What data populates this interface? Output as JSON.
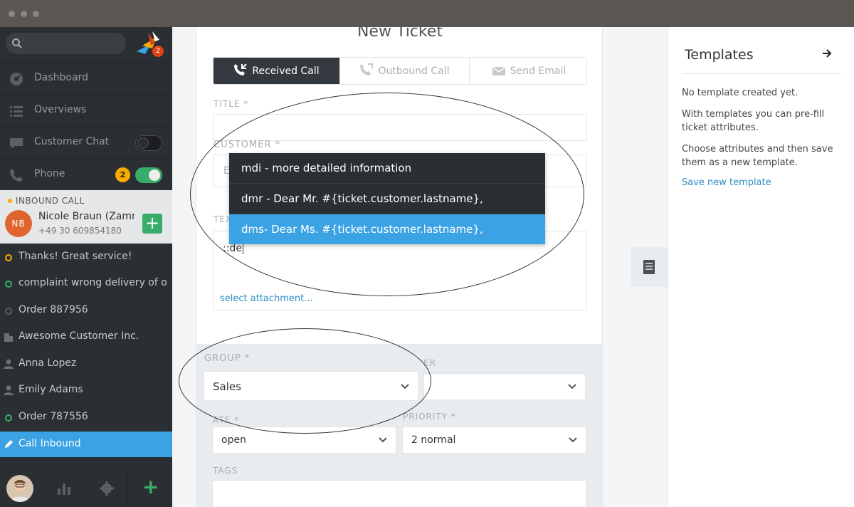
{
  "sidebar": {
    "logo_badge": "2",
    "nav": [
      {
        "label": "Dashboard",
        "icon": "dashboard-icon"
      },
      {
        "label": "Overviews",
        "icon": "list-icon"
      },
      {
        "label": "Customer Chat",
        "icon": "chat-icon",
        "toggle": "off"
      },
      {
        "label": "Phone",
        "icon": "phone-icon",
        "badge": "2",
        "toggle": "on"
      }
    ],
    "inbound": {
      "title": "INBOUND CALL",
      "initials": "NB",
      "name": "Nicole Braun (Zamm...",
      "number": "+49 30 609854180",
      "add": "+"
    },
    "tasks": [
      {
        "label": "Thanks! Great service!",
        "status": "#faab00"
      },
      {
        "label": "complaint wrong delivery of ord...",
        "status": "#38ad69"
      },
      {
        "label": "Order 887956",
        "status": "#5a6066"
      },
      {
        "label": "Awesome Customer Inc.",
        "icon": "organization-icon"
      },
      {
        "label": "Anna Lopez",
        "icon": "user-icon"
      },
      {
        "label": "Emily Adams",
        "icon": "user-icon"
      },
      {
        "label": "Order 787556",
        "status": "#38ad69"
      },
      {
        "label": "Call Inbound",
        "icon": "pencil-icon",
        "active": true
      }
    ],
    "bottom_add": "+"
  },
  "form": {
    "title": "New Ticket",
    "tabs": [
      "Received Call",
      "Outbound Call",
      "Send Email"
    ],
    "title_label": "TITLE *",
    "customer_label": "CUSTOMER *",
    "customer_partial": "E",
    "text_label_partial": "TEX",
    "text_value": "::de",
    "attachment_link": "select attachment...",
    "group_label": "GROUP *",
    "group_value": "Sales",
    "owner_label_partial": "ER",
    "state_label_partial": "ATE *",
    "state_value": "open",
    "priority_label": "PRIORITY *",
    "priority_value": "2 normal",
    "tags_label": "TAGS"
  },
  "autocomplete": [
    {
      "text": "mdi - more detailed information"
    },
    {
      "text": "dmr - Dear Mr. #{ticket.customer.lastname},"
    },
    {
      "text": "dms- Dear Ms. #{ticket.customer.lastname},",
      "highlighted": true
    }
  ],
  "templates": {
    "title": "Templates",
    "empty": "No template created yet.",
    "desc1": "With templates you can pre-fill ticket attributes.",
    "desc2": "Choose attributes and then save them as a new template.",
    "save_link": "Save new template"
  },
  "colors": {
    "accent": "#3ba2e3",
    "success": "#38ad69",
    "warning": "#faab00",
    "sidebar_bg": "#2b2f33"
  }
}
